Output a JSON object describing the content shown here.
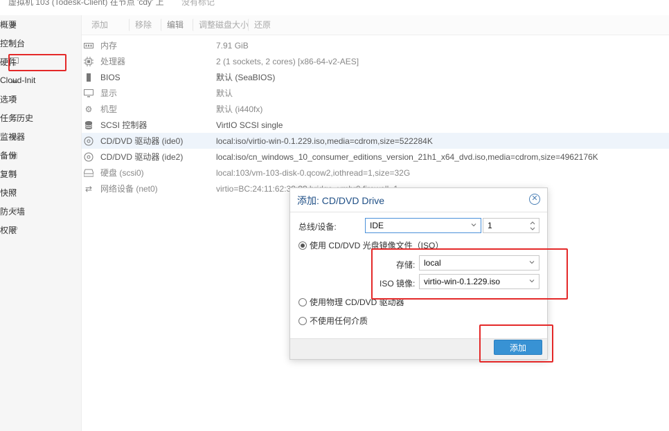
{
  "titlebar": {
    "title": "虚拟机 103 (Todesk-Client) 在节点 'cdy' 上",
    "note": "没有标记"
  },
  "sidebar": {
    "items": [
      {
        "label": "概要",
        "icon": "book-icon"
      },
      {
        "label": "控制台",
        "icon": "terminal-icon"
      },
      {
        "label": "硬件",
        "icon": "monitor-icon"
      },
      {
        "label": "Cloud-Init",
        "icon": "cloud-icon"
      },
      {
        "label": "选项",
        "icon": "gear-icon"
      },
      {
        "label": "任务历史",
        "icon": "list-icon"
      },
      {
        "label": "监视器",
        "icon": "eye-icon"
      },
      {
        "label": "备份",
        "icon": "floppy-icon"
      },
      {
        "label": "复制",
        "icon": "retweet-icon"
      },
      {
        "label": "快照",
        "icon": "history-icon"
      },
      {
        "label": "防火墙",
        "icon": "shield-icon"
      },
      {
        "label": "权限",
        "icon": "unlock-icon"
      }
    ]
  },
  "toolbar": {
    "add": "添加",
    "remove": "移除",
    "edit": "编辑",
    "resize": "调整磁盘大小",
    "revert": "还原"
  },
  "hardware": {
    "rows": [
      {
        "name": "内存",
        "value": "7.91 GiB",
        "icon": "memory-icon"
      },
      {
        "name": "处理器",
        "value": "2 (1 sockets, 2 cores) [x86-64-v2-AES]",
        "icon": "cpu-icon"
      },
      {
        "name": "BIOS",
        "value": "默认 (SeaBIOS)",
        "icon": "chip-icon"
      },
      {
        "name": "显示",
        "value": "默认",
        "icon": "desktop-icon"
      },
      {
        "name": "机型",
        "value": "默认 (i440fx)",
        "icon": "cogs-icon"
      },
      {
        "name": "SCSI 控制器",
        "value": "VirtIO SCSI single",
        "icon": "database-icon"
      },
      {
        "name": "CD/DVD 驱动器 (ide0)",
        "value": "local:iso/virtio-win-0.1.229.iso,media=cdrom,size=522284K",
        "icon": "cdrom-icon"
      },
      {
        "name": "CD/DVD 驱动器 (ide2)",
        "value": "local:iso/cn_windows_10_consumer_editions_version_21h1_x64_dvd.iso,media=cdrom,size=4962176K",
        "icon": "cdrom-icon"
      },
      {
        "name": "硬盘 (scsi0)",
        "value": "local:103/vm-103-disk-0.qcow2,iothread=1,size=32G",
        "icon": "hdd-icon"
      },
      {
        "name": "网络设备 (net0)",
        "value": "virtio=BC:24:11:62:3?:??,bridge=vmbr0,firewall=1",
        "icon": "network-icon"
      }
    ]
  },
  "dialog": {
    "title": "添加: CD/DVD Drive",
    "bus_label": "总线/设备:",
    "bus_value": "IDE",
    "device_number": "1",
    "option_iso": "使用 CD/DVD 光盘镜像文件（ISO）",
    "storage_label": "存储:",
    "storage_value": "local",
    "iso_label": "ISO 镜像:",
    "iso_value": "virtio-win-0.1.229.iso",
    "option_physical": "使用物理 CD/DVD 驱动器",
    "option_none": "不使用任何介质",
    "add_button": "添加"
  },
  "colors": {
    "accent": "#3892d4",
    "annotation": "#e42828",
    "title_blue": "#1f4f86"
  }
}
